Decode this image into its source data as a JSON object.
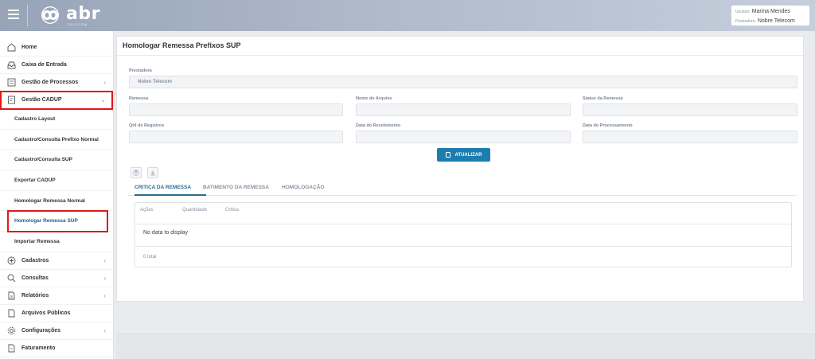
{
  "header": {
    "logo_text": "abr",
    "logo_sub": "TELECOM",
    "user_label": "Usuário:",
    "user_name": "Marina Mendes",
    "provider_label": "Prestadora:",
    "provider_name": "Nobre Telecom"
  },
  "sidebar": {
    "items": [
      {
        "label": "Home",
        "icon": "home-icon"
      },
      {
        "label": "Caixa de Entrada",
        "icon": "inbox-icon"
      },
      {
        "label": "Gestão de Processos",
        "icon": "process-icon",
        "chevron": "‹"
      },
      {
        "label": "Gestão CADUP",
        "icon": "cadup-icon",
        "chevron": "⌄"
      }
    ],
    "subitems": [
      "Cadastro Layout",
      "Cadastro/Consulta Prefixo Normal",
      "Cadastro/Consulta SUP",
      "Exportar CADUP",
      "Homologar Remessa Normal",
      "Homologar Remessa SUP",
      "Importar Remessa"
    ],
    "bottom_items": [
      {
        "label": "Cadastros",
        "icon": "plus-circle-icon",
        "chevron": "‹"
      },
      {
        "label": "Consultas",
        "icon": "search-icon",
        "chevron": "‹"
      },
      {
        "label": "Relatórios",
        "icon": "report-icon",
        "chevron": "‹"
      },
      {
        "label": "Arquivos Públicos",
        "icon": "file-icon"
      },
      {
        "label": "Configurações",
        "icon": "gear-icon",
        "chevron": "‹"
      },
      {
        "label": "Faturamento",
        "icon": "billing-icon"
      }
    ]
  },
  "main": {
    "title": "Homologar Remessa Prefixos SUP",
    "fields": {
      "prestadora_label": "Prestadora",
      "prestadora_value": "Nobre Telecom",
      "remessa_label": "Remessa",
      "nome_arquivo_label": "Nome do Arquivo",
      "status_label": "Status da Remessa",
      "qtd_label": "Qtd de Registros",
      "data_receb_label": "Data do Recebimento",
      "data_proc_label": "Data do Processamento"
    },
    "update_button": "ATUALIZAR",
    "tabs": [
      "CRITICA DA REMESSA",
      "BATIMENTO DA REMESSA",
      "HOMOLOGAÇÃO"
    ],
    "grid": {
      "columns": [
        "Ações",
        "Quantidade",
        "Critica"
      ],
      "empty_text": "No data to display",
      "total_text": "0 total"
    }
  },
  "colors": {
    "accent": "#1c7eb0",
    "tab_active": "#2a6d96",
    "highlight_border": "#e01919"
  }
}
